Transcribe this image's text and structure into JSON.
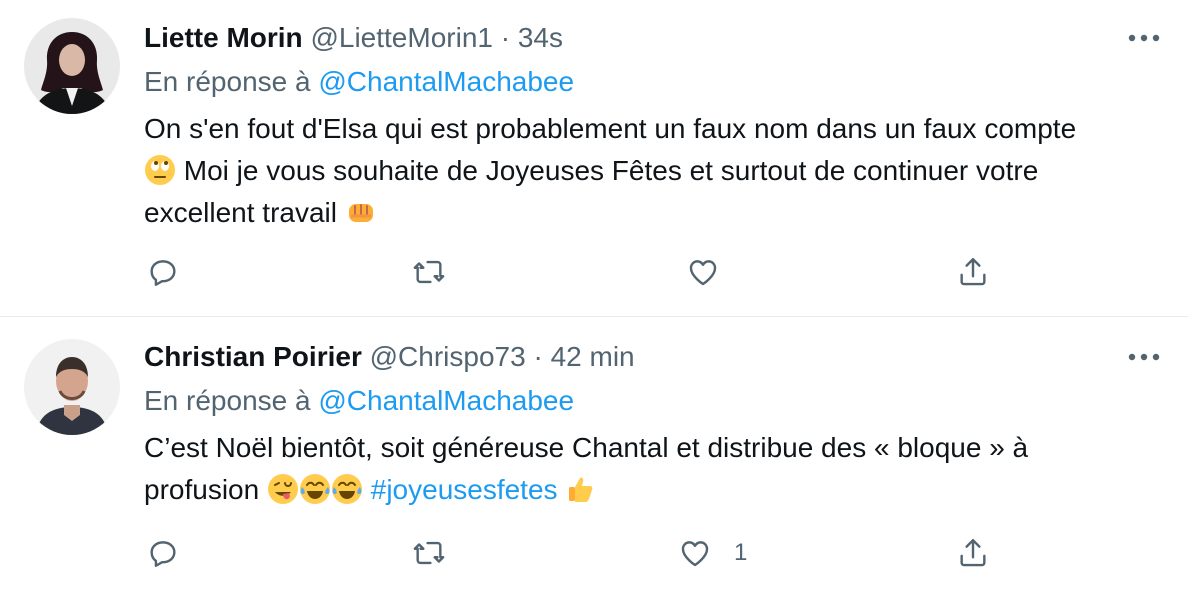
{
  "tweets": [
    {
      "name": "Liette Morin",
      "handle": "@LietteMorin1",
      "separator": "·",
      "time": "34s",
      "reply_prefix": "En réponse à",
      "reply_mention": "@ChantalMachabee",
      "body_line1": "On s'en fout d'Elsa qui est probablement un faux nom dans un faux compte",
      "body_line2": "Moi je vous souhaite de Joyeuses Fêtes et surtout de continuer votre",
      "body_line3": "excellent travail",
      "emojis": [
        "face-with-rolling-eyes",
        "oncoming-fist"
      ],
      "like_count": ""
    },
    {
      "name": "Christian Poirier",
      "handle": "@Chrispo73",
      "separator": "·",
      "time": "42 min",
      "reply_prefix": "En réponse à",
      "reply_mention": "@ChantalMachabee",
      "body_line1": "C’est Noël bientôt, soit généreuse Chantal et distribue des « bloque » à",
      "body_line2": "profusion",
      "hashtag": "#joyeusesfetes",
      "emojis": [
        "winking-face-with-tongue",
        "face-with-tears-of-joy",
        "face-with-tears-of-joy",
        "thumbs-up"
      ],
      "like_count": "1"
    }
  ],
  "colors": {
    "text": "#0f1419",
    "secondary": "#536471",
    "link": "#1d9bf0",
    "divider": "#e6ecf0"
  },
  "icons": [
    "reply-icon",
    "retweet-icon",
    "like-icon",
    "share-icon",
    "more-icon"
  ]
}
